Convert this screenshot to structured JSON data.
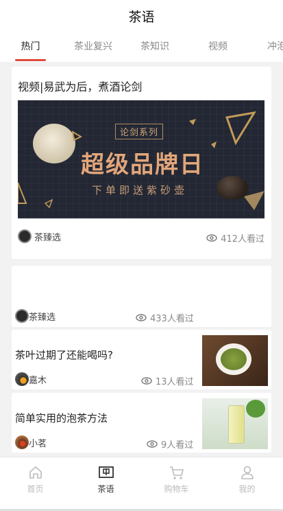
{
  "header": {
    "title": "茶语"
  },
  "tabs": [
    {
      "label": "热门",
      "active": true
    },
    {
      "label": "茶业复兴"
    },
    {
      "label": "茶知识"
    },
    {
      "label": "视频"
    },
    {
      "label": "冲泡"
    }
  ],
  "colors": {
    "accent": "#e04a3a"
  },
  "feed": {
    "featured": {
      "title": "视频|易武为后，煮酒论剑",
      "banner": {
        "series": "论剑系列",
        "headline": "超级品牌日",
        "subline": "下单即送紫砂壶"
      },
      "author": "茶臻选",
      "views": "412人看过"
    },
    "item2": {
      "author": "茶臻选",
      "views": "433人看过"
    },
    "item3": {
      "title": "茶叶过期了还能喝吗?",
      "author": "嘉木",
      "views": "13人看过"
    },
    "item4": {
      "title": "简单实用的泡茶方法",
      "author": "小茗",
      "views": "9人看过"
    }
  },
  "tabbar": [
    {
      "label": "首页",
      "icon": "home-icon"
    },
    {
      "label": "茶语",
      "icon": "tea-talk-icon",
      "active": true
    },
    {
      "label": "购物车",
      "icon": "cart-icon"
    },
    {
      "label": "我的",
      "icon": "user-icon"
    }
  ]
}
